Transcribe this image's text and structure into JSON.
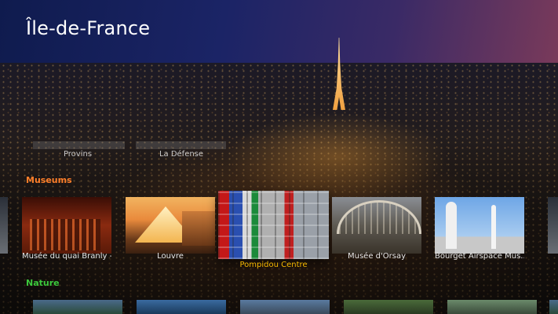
{
  "page_title": "Île-de-France",
  "previous_row": {
    "items": [
      "Provins",
      "La Défense"
    ]
  },
  "sections": [
    {
      "title": "Museums",
      "title_color": "#ff7f2a",
      "items": [
        {
          "label": "Musée du quai Branly -...",
          "focused": false
        },
        {
          "label": "Louvre",
          "focused": false
        },
        {
          "label": "Pompidou Centre",
          "focused": true
        },
        {
          "label": "Musée d'Orsay",
          "focused": false
        },
        {
          "label": "Bourget Airspace Mus...",
          "focused": false
        }
      ]
    },
    {
      "title": "Nature",
      "title_color": "#3cc83c",
      "items": []
    }
  ],
  "colors": {
    "focused_label": "#f5b800",
    "label": "#e8e8e8"
  }
}
